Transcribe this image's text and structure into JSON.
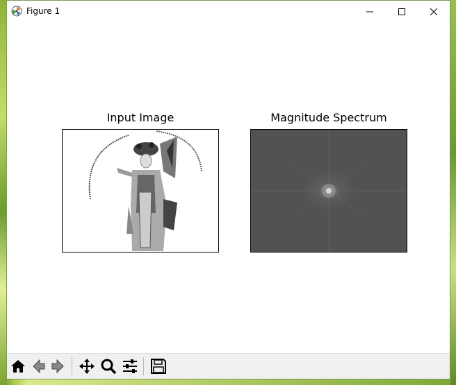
{
  "window": {
    "title": "Figure 1"
  },
  "plots": [
    {
      "title": "Input Image"
    },
    {
      "title": "Magnitude Spectrum"
    }
  ],
  "toolbar": {
    "buttons": [
      "home-icon",
      "back-icon",
      "forward-icon",
      "pan-icon",
      "zoom-icon",
      "configure-subplots-icon",
      "save-icon"
    ]
  }
}
